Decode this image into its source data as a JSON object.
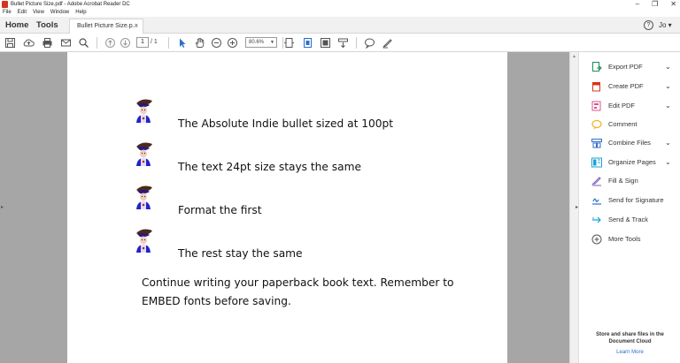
{
  "window": {
    "title": "Bullet Picture Size.pdf - Adobe Acrobat Reader DC",
    "controls": [
      "–",
      "❐",
      "✕"
    ]
  },
  "menu": [
    "File",
    "Edit",
    "View",
    "Window",
    "Help"
  ],
  "tabs": {
    "home": "Home",
    "tools": "Tools",
    "document": "Bullet Picture Size.p...",
    "close": "×",
    "help": "?",
    "user": "Jo ▾"
  },
  "toolbar": {
    "page_current": "1",
    "page_total": "/ 1",
    "zoom": "80.6%",
    "zoom_caret": "▼"
  },
  "document": {
    "bullets": [
      "The Absolute Indie bullet sized at 100pt",
      "The text 24pt size stays the same",
      "Format the first",
      "The rest stay the same"
    ],
    "body_lines": [
      "Continue writing your paperback book text. Remember to",
      "EMBED fonts before saving."
    ]
  },
  "right_pane": {
    "items": [
      {
        "label": "Export PDF",
        "chevron": "⌄",
        "icon": "export-pdf-icon",
        "color": "#1a8f5a"
      },
      {
        "label": "Create PDF",
        "chevron": "⌄",
        "icon": "create-pdf-icon",
        "color": "#d4351c"
      },
      {
        "label": "Edit PDF",
        "chevron": "⌄",
        "icon": "edit-pdf-icon",
        "color": "#e2508c"
      },
      {
        "label": "Comment",
        "chevron": "",
        "icon": "comment-icon",
        "color": "#f1b21e"
      },
      {
        "label": "Combine Files",
        "chevron": "⌄",
        "icon": "combine-files-icon",
        "color": "#2d6ecb"
      },
      {
        "label": "Organize Pages",
        "chevron": "⌄",
        "icon": "organize-pages-icon",
        "color": "#1ba1d8"
      },
      {
        "label": "Fill & Sign",
        "chevron": "",
        "icon": "fill-sign-icon",
        "color": "#7b5bc2"
      },
      {
        "label": "Send for Signature",
        "chevron": "",
        "icon": "send-signature-icon",
        "color": "#2d6ecb"
      },
      {
        "label": "Send & Track",
        "chevron": "",
        "icon": "send-track-icon",
        "color": "#1ba1d8"
      },
      {
        "label": "More Tools",
        "chevron": "",
        "icon": "more-tools-icon",
        "color": "#555555"
      }
    ],
    "footer_line1": "Store and share files in the",
    "footer_line2": "Document Cloud",
    "footer_link": "Learn More"
  }
}
